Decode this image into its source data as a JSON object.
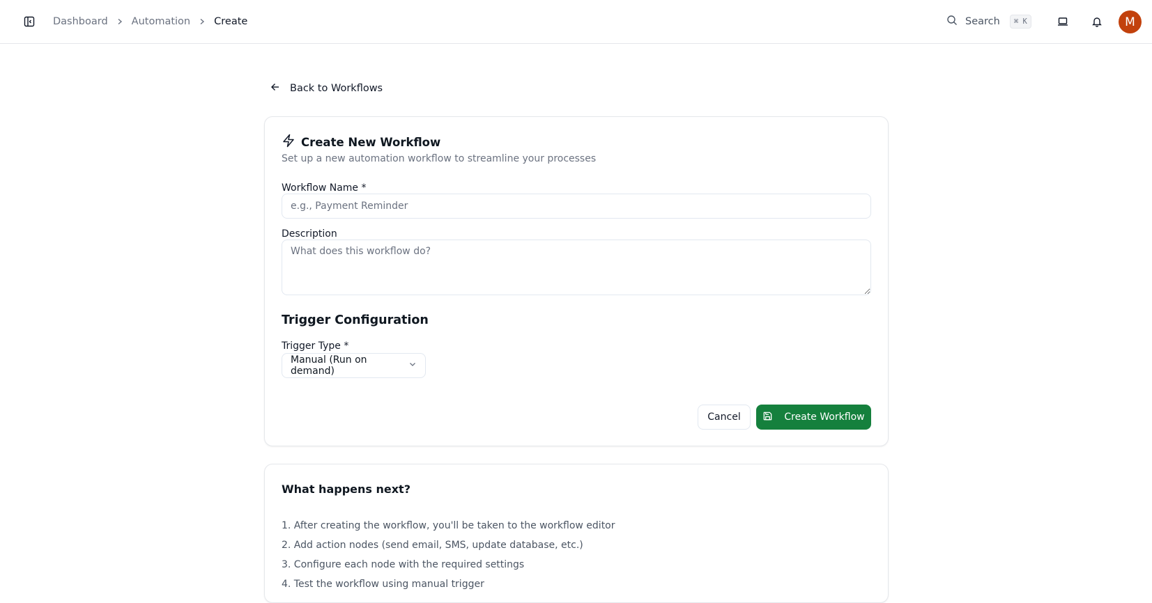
{
  "breadcrumb": {
    "items": [
      "Dashboard",
      "Automation"
    ],
    "current": "Create"
  },
  "header": {
    "search_label": "Search",
    "search_shortcut": "⌘ K",
    "avatar_initial": "M",
    "avatar_color": "#c2410c"
  },
  "back_link": "Back to Workflows",
  "form": {
    "title": "Create New Workflow",
    "subtitle": "Set up a new automation workflow to streamline your processes",
    "name_label": "Workflow Name *",
    "name_value": "",
    "name_placeholder": "e.g., Payment Reminder",
    "description_label": "Description",
    "description_value": "",
    "description_placeholder": "What does this workflow do?",
    "trigger_section_title": "Trigger Configuration",
    "trigger_type_label": "Trigger Type *",
    "trigger_type_value": "Manual (Run on demand)",
    "cancel_label": "Cancel",
    "create_label": "Create Workflow",
    "create_color": "#15803d"
  },
  "next_steps": {
    "title": "What happens next?",
    "items": [
      "1. After creating the workflow, you'll be taken to the workflow editor",
      "2. Add action nodes (send email, SMS, update database, etc.)",
      "3. Configure each node with the required settings",
      "4. Test the workflow using manual trigger"
    ]
  },
  "icons": {
    "sidebar_toggle": "panel-left-icon",
    "search": "search-icon",
    "inbox": "inbox-icon",
    "bell": "bell-icon",
    "back": "arrow-left-icon",
    "title": "lightning-icon",
    "select": "chevron-down-icon",
    "save": "save-icon"
  }
}
